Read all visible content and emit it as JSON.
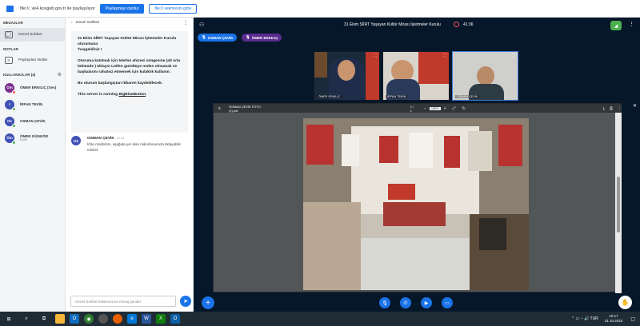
{
  "share_bar": {
    "text": "file://, vk4.kosgeb.gov.tr ile paylaşılıyor",
    "stop_button": "Paylaşmayı durdur",
    "hide_button": "file:// sekmesini gizle"
  },
  "users_panel": {
    "messages_title": "MESAJLAR",
    "public_chat": "Genel Sohbet",
    "notes_title": "NOTLAR",
    "shared_notes": "Paylaşılan Notlar",
    "users_title": "KULLANICILAR (4)",
    "users": [
      {
        "initials": "Öm",
        "name": "ÖMER ERKILIÇ (Sen)",
        "role": "",
        "color": "#7b2d8e",
        "dot": "#ff4d4d"
      },
      {
        "initials": "İ",
        "name": "İRFAN TEKİN",
        "role": "",
        "color": "#3f51b5",
        "dot": "#4caf50"
      },
      {
        "initials": "Os",
        "name": "OSMAN ÇEVİK",
        "role": "",
        "color": "#3f51b5",
        "dot": "#4caf50"
      },
      {
        "initials": "Öm",
        "name": "ÖMER GÜNGÖR",
        "role": "Mobil",
        "color": "#3f51b5",
        "dot": "#4caf50"
      }
    ]
  },
  "chat": {
    "header": "Genel Sohbet",
    "welcome_title": "31 Ekim SİİRT Yaşayan Kültür Mirası İşletmeler Kurulu oturumuna",
    "welcome_greeting": "'hoşgeldiniz !",
    "welcome_body": "Oturuma katılmak için telefon ahizesi simgesine (alt orta bölümde ) tıklayın Lütfen gürültüye neden olmamak ve başkalarını rahatsız etmemek için kulaklık kullanın.",
    "recording_note": "Bu oturum başlangıçtan itibaren kaydedilecek.",
    "running_prefix": "This server is running ",
    "running_link": "BigBlueButton",
    "running_suffix": ".",
    "message": {
      "initials": "Os",
      "name": "OSMAN ÇEVİK",
      "time": "10:12",
      "text": "İrfan müdürüm, aşağıda yer alan mikrofonunuza tıklayabilir misiniz"
    },
    "input_placeholder": "Genel Sohbet kullanıcısına mesaj gönder"
  },
  "main": {
    "meeting_title": "31 Ekim SİİRT Yaşayan Kültür Mirası İşletmeler Kurulu",
    "timer": "41:36",
    "talker_1": "OSMAN ÇEVİK",
    "talker_2": "ÖMER ERKILIÇ",
    "videos": [
      "ÖMER ERKILIÇ",
      "İRFAN TEKİN",
      "OSMAN ÇEVİK"
    ],
    "document_title": "OSMAN ÇEVİK FOTO (1).pdf",
    "page_indicator": "1 / 1",
    "zoom_level": "100%"
  },
  "taskbar": {
    "time": "10:17",
    "date": "31.10.2022"
  }
}
